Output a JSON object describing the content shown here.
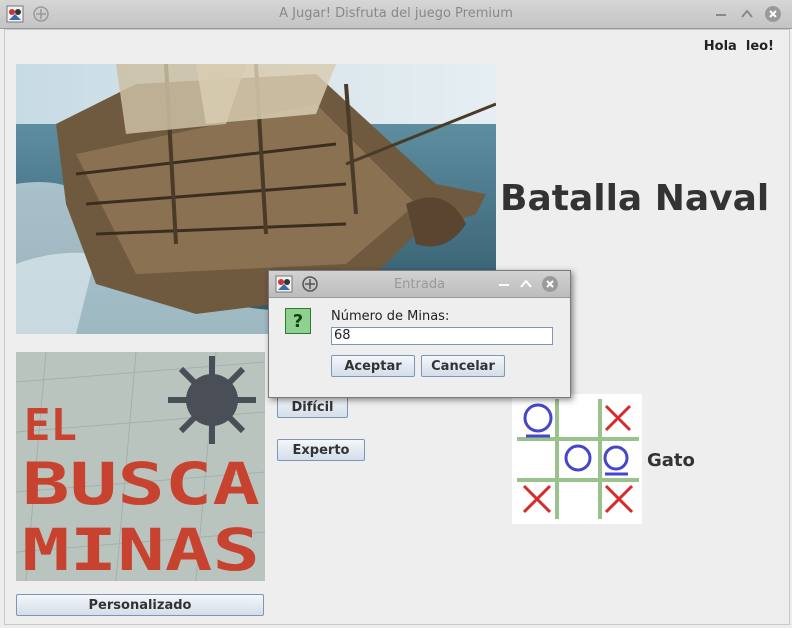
{
  "window": {
    "title": "A Jugar! Disfruta del juego Premium"
  },
  "greeting": "Hola  leo!",
  "batalla": {
    "label": "Batalla Naval"
  },
  "buscaminas": {
    "logo_text": [
      "EL",
      "BUSCA",
      "MINAS"
    ],
    "buttons": {
      "dificil": "Difícil",
      "experto": "Experto",
      "personalizado": "Personalizado"
    }
  },
  "gato": {
    "label": "Gato"
  },
  "dialog": {
    "title": "Entrada",
    "prompt": "Número de Minas:",
    "input_value": "68",
    "accept": "Aceptar",
    "cancel": "Cancelar"
  }
}
